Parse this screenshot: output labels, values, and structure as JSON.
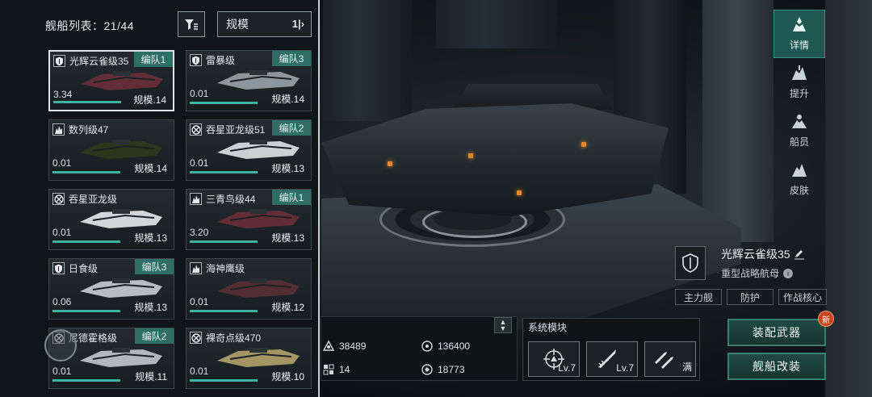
{
  "list": {
    "title": "舰船列表：21/44",
    "sort_label": "规模"
  },
  "ships": [
    {
      "name": "光辉云雀级35",
      "fleet": "编队1",
      "value": "3.34",
      "scale": "规模.14",
      "icon": "shield-icon",
      "selected": true,
      "progress": 1.0
    },
    {
      "name": "雷暴级",
      "fleet": "编队3",
      "value": "0.01",
      "scale": "规模.14",
      "icon": "shield-icon",
      "selected": false,
      "progress": 1.0
    },
    {
      "name": "数列级47",
      "fleet": "",
      "value": "0.01",
      "scale": "规模.14",
      "icon": "flame-icon",
      "selected": false,
      "progress": 1.0
    },
    {
      "name": "吞星亚龙级51",
      "fleet": "编队2",
      "value": "0.01",
      "scale": "规模.13",
      "icon": "target-icon",
      "selected": false,
      "progress": 1.0
    },
    {
      "name": "吞星亚龙级",
      "fleet": "",
      "value": "0.01",
      "scale": "规模.13",
      "icon": "target-icon",
      "selected": false,
      "progress": 1.0
    },
    {
      "name": "三青鸟级44",
      "fleet": "编队1",
      "value": "3.20",
      "scale": "规模.13",
      "icon": "flame-icon",
      "selected": false,
      "progress": 1.0
    },
    {
      "name": "日食级",
      "fleet": "编队3",
      "value": "0.06",
      "scale": "规模.13",
      "icon": "shield-icon",
      "selected": false,
      "progress": 1.0
    },
    {
      "name": "海神鹰级",
      "fleet": "",
      "value": "0.01",
      "scale": "规模.12",
      "icon": "flame-icon",
      "selected": false,
      "progress": 1.0
    },
    {
      "name": "尼德霍格级",
      "fleet": "编队2",
      "value": "0.01",
      "scale": "规模.11",
      "icon": "target-icon",
      "selected": false,
      "progress": 1.0
    },
    {
      "name": "裸奇点级470",
      "fleet": "",
      "value": "0.01",
      "scale": "规模.10",
      "icon": "target-icon",
      "selected": false,
      "progress": 1.0
    }
  ],
  "nav": [
    "详情",
    "提升",
    "船员",
    "皮肤"
  ],
  "ship_info": {
    "name": "光辉云雀级35",
    "type": "重型战略航母",
    "tags": [
      "主力舰",
      "防护",
      "作战核心"
    ]
  },
  "stats": {
    "a": "38489",
    "b": "136400",
    "c": "14",
    "d": "18773"
  },
  "modules": {
    "title": "系统模块",
    "levels": [
      "Lv.7",
      "Lv.7",
      "满"
    ]
  },
  "actions": {
    "equip": "装配武器",
    "refit": "舰船改装",
    "new_badge": "新"
  },
  "colors": {
    "accent": "#3fb3a1",
    "fleet_tag": "#2f6e66",
    "badge": "#c9441f"
  }
}
